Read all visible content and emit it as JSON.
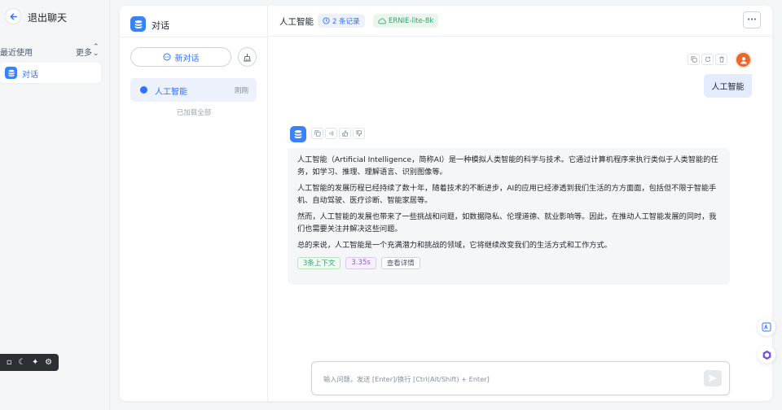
{
  "sidebar": {
    "back_label": "退出聊天",
    "recent_label": "最近使用",
    "more_label": "更多",
    "recent_items": [
      {
        "label": "对话"
      }
    ]
  },
  "chat_list": {
    "title": "对话",
    "new_chat_label": "新对话",
    "items": [
      {
        "name": "人工智能",
        "time": "刚刚"
      }
    ],
    "loaded_all": "已加载全部"
  },
  "conversation": {
    "title": "人工智能",
    "records_badge": "2 条记录",
    "model_badge": "ERNIE-lite-8k",
    "user_message": "人工智能",
    "ai_paragraphs": [
      "人工智能（Artificial Intelligence，简称AI）是一种模拟人类智能的科学与技术。它通过计算机程序来执行类似于人类智能的任务，如学习、推理、理解语言、识别图像等。",
      "人工智能的发展历程已经持续了数十年，随着技术的不断进步，AI的应用已经渗透到我们生活的方方面面，包括但不限于智能手机、自动驾驶、医疗诊断、智能家居等。",
      "然而，人工智能的发展也带来了一些挑战和问题，如数据隐私、伦理道德、就业影响等。因此，在推动人工智能发展的同时，我们也需要关注并解决这些问题。",
      "总的来说，人工智能是一个充满潜力和挑战的领域，它将继续改变我们的生活方式和工作方式。"
    ],
    "tags": {
      "context": "3条上下文",
      "duration": "3.35s",
      "details": "查看详情"
    },
    "input_placeholder": "输入问题，发送 [Enter]/换行 [Ctrl(Alt/Shift) + Enter]"
  },
  "colors": {
    "accent": "#3370ff",
    "app_icon": "#3a83f7",
    "user_avatar": "#e8692e",
    "user_bubble": "#e3ebfc",
    "ai_bubble": "#f5f6f8"
  }
}
